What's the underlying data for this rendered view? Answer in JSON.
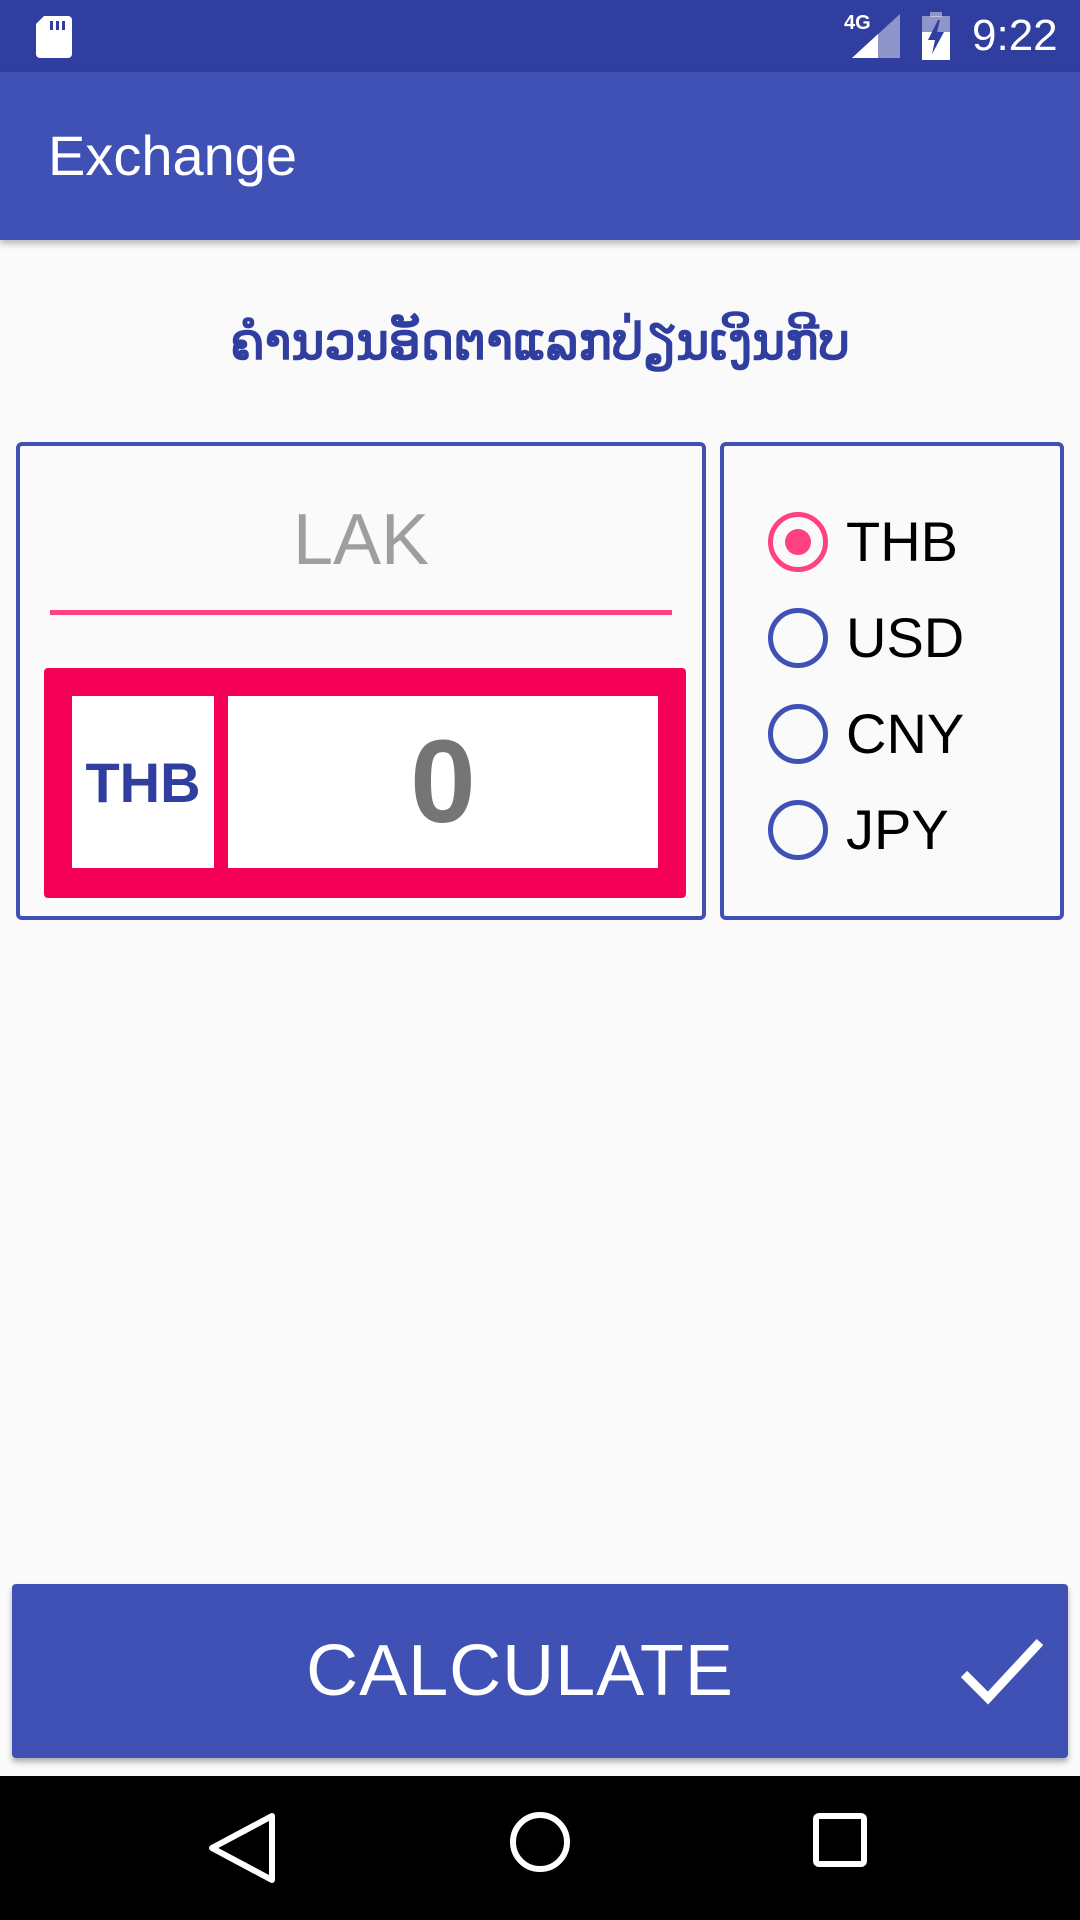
{
  "status_bar": {
    "network": "4G",
    "time": "9:22",
    "icons": [
      "sd-card-icon",
      "signal-icon",
      "battery-charging-icon"
    ]
  },
  "app_bar": {
    "title": "Exchange"
  },
  "heading": "ຄຳນວນອັດຕາແລກປ່ຽນເງິນກີບ",
  "input": {
    "placeholder": "LAK",
    "value": ""
  },
  "result": {
    "currency": "THB",
    "value": "0"
  },
  "currencies": {
    "selected": "THB",
    "options": [
      {
        "label": "THB",
        "checked": true
      },
      {
        "label": "USD",
        "checked": false
      },
      {
        "label": "CNY",
        "checked": false
      },
      {
        "label": "JPY",
        "checked": false
      }
    ]
  },
  "button": {
    "label": "CALCULATE",
    "icon": "check-icon"
  },
  "nav_bar": {
    "icons": [
      "back-icon",
      "home-icon",
      "recents-icon"
    ]
  },
  "colors": {
    "primary_dark": "#303f9f",
    "primary": "#3f51b5",
    "accent": "#ff4081",
    "result_border": "#f50057"
  }
}
